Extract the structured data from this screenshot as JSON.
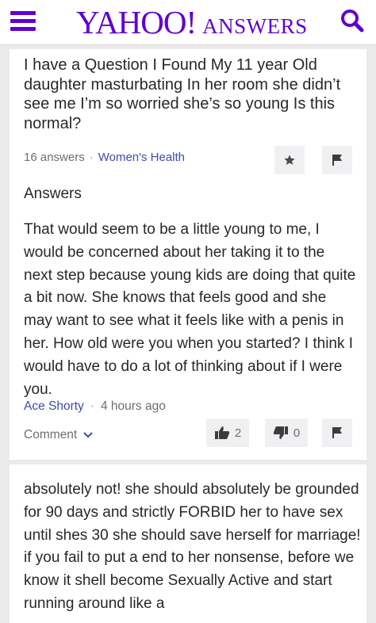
{
  "header": {
    "logo_main": "YAHOO!",
    "logo_sub": "ANSWERS",
    "menu_icon": "hamburger-menu-icon",
    "search_icon": "search-icon",
    "brand_color": "#5f01d1"
  },
  "question": {
    "title": "I have a Question I Found My 11 year Old daughter masturbating In her room she didn’t see me I’m so worried she’s so young Is this normal?",
    "answer_count": "16 answers",
    "separator": "·",
    "category": "Women's Health",
    "star_icon": "star-icon",
    "flag_icon": "flag-icon"
  },
  "answers_heading": "Answers",
  "answers": [
    {
      "text": "That would seem to be a little young to me, I would be concerned about her taking it to the next step because young kids are doing that quite a bit now. She knows that feels good and she may want to see what it feels like with a penis in her. How old were you when you started? I think I would have to do a lot of thinking about if I were you.",
      "author": "Ace Shorty",
      "separator": "·",
      "time": "4 hours ago",
      "comment_label": "Comment",
      "thumbs_up_count": "2",
      "thumbs_down_count": "0"
    },
    {
      "text": "absolutely not! she should absolutely be grounded for 90 days and strictly FORBID her to have sex until shes 30 she should save herself for marriage! if you fail to put a end to her nonsense, before we know it shell become Sexually Active and start running around like a"
    }
  ]
}
